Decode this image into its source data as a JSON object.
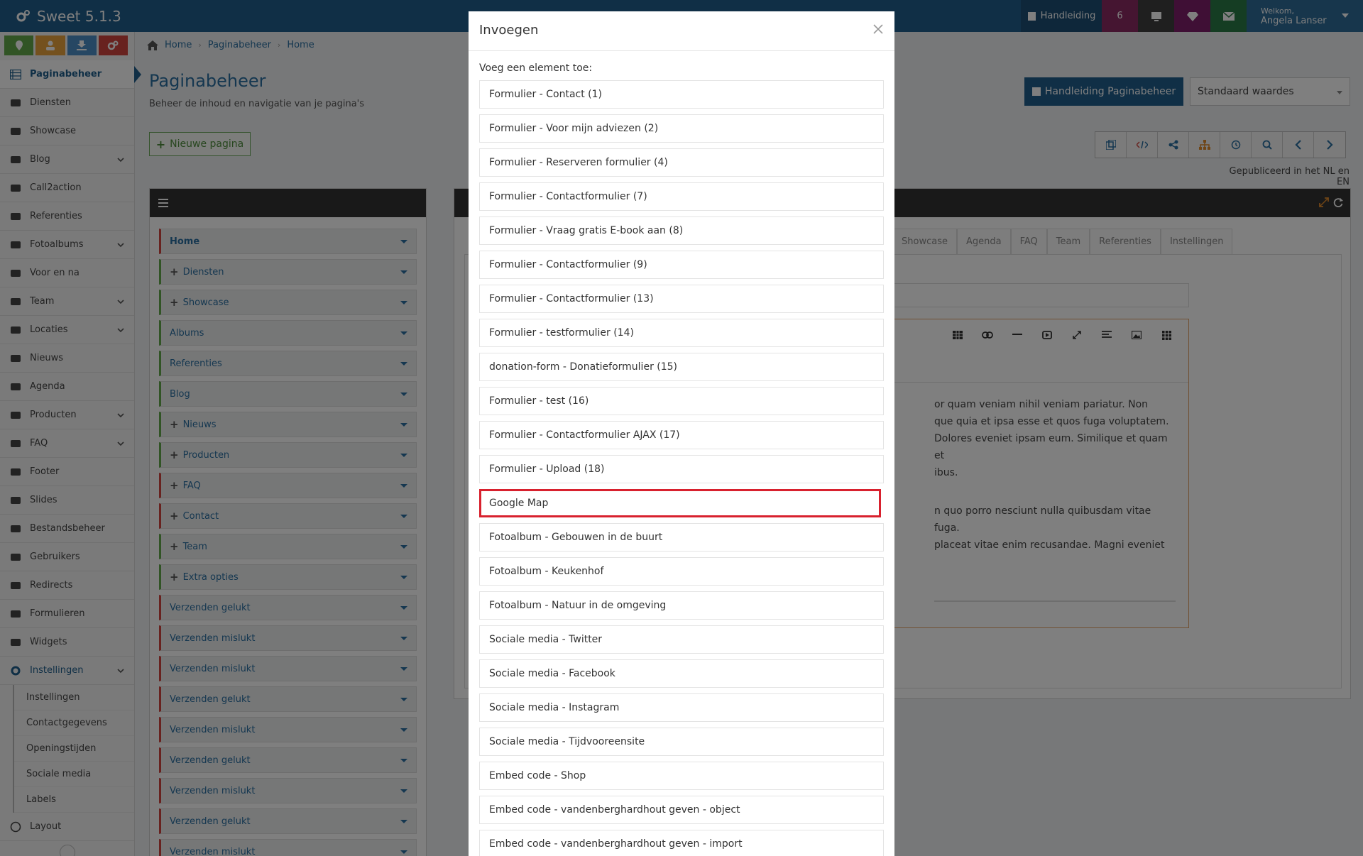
{
  "app": {
    "title": "Sweet 5.1.3"
  },
  "topbar": {
    "manual_label": "Handleiding",
    "notification_count": "6",
    "welcome": "Welkom,",
    "user_name": "Angela Lanser"
  },
  "sidebar": {
    "items": [
      {
        "label": "Paginabeheer",
        "icon": "list-icon"
      },
      {
        "label": "Diensten",
        "icon": "cubes-icon"
      },
      {
        "label": "Showcase",
        "icon": "grid-icon"
      },
      {
        "label": "Blog",
        "icon": "book-icon"
      },
      {
        "label": "Call2action",
        "icon": "phone-icon"
      },
      {
        "label": "Referenties",
        "icon": "comments-icon"
      },
      {
        "label": "Fotoalbums",
        "icon": "album-icon"
      },
      {
        "label": "Voor en na",
        "icon": "arrows-icon"
      },
      {
        "label": "Team",
        "icon": "users-icon"
      },
      {
        "label": "Locaties",
        "icon": "map-marker-icon"
      },
      {
        "label": "Nieuws",
        "icon": "newspaper-icon"
      },
      {
        "label": "Agenda",
        "icon": "calendar-icon"
      },
      {
        "label": "Producten",
        "icon": "tags-icon"
      },
      {
        "label": "FAQ",
        "icon": "question-icon"
      },
      {
        "label": "Footer",
        "icon": "footer-icon"
      },
      {
        "label": "Slides",
        "icon": "sliders-icon"
      },
      {
        "label": "Bestandsbeheer",
        "icon": "folder-icon"
      },
      {
        "label": "Gebruikers",
        "icon": "user-icon"
      },
      {
        "label": "Redirects",
        "icon": "redirect-icon"
      },
      {
        "label": "Formulieren",
        "icon": "form-icon"
      },
      {
        "label": "Widgets",
        "icon": "widget-icon"
      },
      {
        "label": "Instellingen",
        "icon": "gear-icon"
      }
    ],
    "sub_items": [
      "Instellingen",
      "Contactgegevens",
      "Openingstijden",
      "Sociale media",
      "Labels"
    ],
    "last_item": "Layout"
  },
  "breadcrumb": [
    "Home",
    "Paginabeheer",
    "Home"
  ],
  "page": {
    "title": "Paginabeheer",
    "subtitle": "Beheer de inhoud en navigatie van je pagina's",
    "new_page_label": "Nieuwe pagina",
    "manual_button": "Handleiding Paginabeheer",
    "select_value": "Standaard waardes",
    "published": "Gepubliceerd in het NL en EN"
  },
  "tree": {
    "items": [
      {
        "label": "Home",
        "plus": false,
        "color": "red"
      },
      {
        "label": "Diensten",
        "plus": true,
        "color": "green"
      },
      {
        "label": "Showcase",
        "plus": true,
        "color": "green"
      },
      {
        "label": "Albums",
        "plus": false,
        "color": "green"
      },
      {
        "label": "Referenties",
        "plus": false,
        "color": "green"
      },
      {
        "label": "Blog",
        "plus": false,
        "color": "green"
      },
      {
        "label": "Nieuws",
        "plus": true,
        "color": "green"
      },
      {
        "label": "Producten",
        "plus": true,
        "color": "green"
      },
      {
        "label": "FAQ",
        "plus": true,
        "color": "red"
      },
      {
        "label": "Contact",
        "plus": true,
        "color": "red"
      },
      {
        "label": "Team",
        "plus": true,
        "color": "green"
      },
      {
        "label": "Extra opties",
        "plus": true,
        "color": "green"
      },
      {
        "label": "Verzenden gelukt",
        "plus": false,
        "color": "red"
      },
      {
        "label": "Verzenden mislukt",
        "plus": false,
        "color": "red"
      },
      {
        "label": "Verzenden mislukt",
        "plus": false,
        "color": "red"
      },
      {
        "label": "Verzenden gelukt",
        "plus": false,
        "color": "red"
      },
      {
        "label": "Verzenden mislukt",
        "plus": false,
        "color": "red"
      },
      {
        "label": "Verzenden gelukt",
        "plus": false,
        "color": "red"
      },
      {
        "label": "Verzenden mislukt",
        "plus": false,
        "color": "red"
      },
      {
        "label": "Verzenden gelukt",
        "plus": false,
        "color": "red"
      },
      {
        "label": "Verzenden mislukt",
        "plus": false,
        "color": "red"
      }
    ]
  },
  "editor": {
    "tabs": [
      "Showcase",
      "Agenda",
      "FAQ",
      "Team",
      "Referenties",
      "Instellingen"
    ],
    "text_lines_1": [
      "or quam veniam nihil veniam pariatur. Non",
      "que quia et ipsa esse et quos fuga voluptatem.",
      "Dolores eveniet ipsam eum. Similique et quam et",
      "ibus."
    ],
    "text_lines_2": [
      "n quo porro nesciunt nulla quibusdam vitae fuga.",
      "placeat vitae enim recusandae. Magni eveniet"
    ]
  },
  "modal": {
    "title": "Invoegen",
    "label": "Voeg een element toe:",
    "options": [
      "Formulier - Contact (1)",
      "Formulier - Voor mijn adviezen (2)",
      "Formulier - Reserveren formulier (4)",
      "Formulier - Contactformulier (7)",
      "Formulier - Vraag gratis E-book aan (8)",
      "Formulier - Contactformulier (9)",
      "Formulier - Contactformulier (13)",
      "Formulier - testformulier (14)",
      "donation-form - Donatieformulier (15)",
      "Formulier - test (16)",
      "Formulier - Contactformulier AJAX (17)",
      "Formulier - Upload (18)",
      "Google Map",
      "Fotoalbum - Gebouwen in de buurt",
      "Fotoalbum - Keukenhof",
      "Fotoalbum - Natuur in de omgeving",
      "Sociale media - Twitter",
      "Sociale media - Facebook",
      "Sociale media - Instagram",
      "Sociale media - Tijdvooreensite",
      "Embed code - Shop",
      "Embed code - vandenberghardhout geven - object",
      "Embed code - vandenberghardhout geven - import"
    ],
    "highlighted_index": 12
  },
  "colors": {
    "primary": "#215f8d",
    "highlight": "#d8212e",
    "green": "#62a94b",
    "red": "#d0453f"
  }
}
